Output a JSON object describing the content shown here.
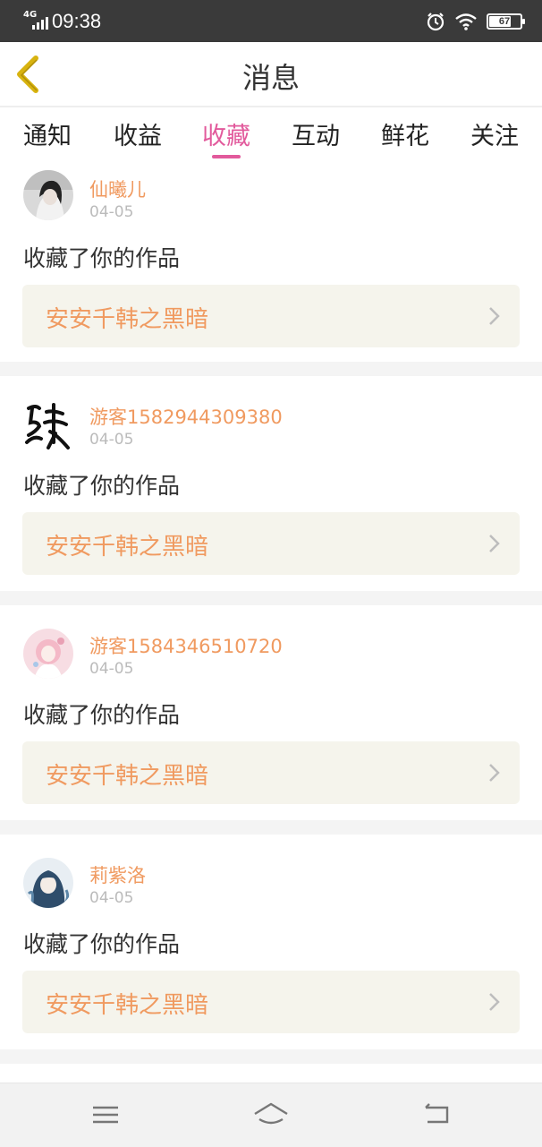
{
  "status_bar": {
    "network": "4G",
    "time": "09:38",
    "battery": "67",
    "battery_level": 0.67,
    "icons": [
      "signal-icon",
      "alarm-icon",
      "wifi-icon",
      "battery-icon"
    ]
  },
  "header": {
    "title": "消息",
    "back_icon": "chevron-left-icon"
  },
  "tabs": [
    {
      "label": "通知"
    },
    {
      "label": "收益"
    },
    {
      "label": "收藏",
      "active": true
    },
    {
      "label": "互动"
    },
    {
      "label": "鲜花"
    },
    {
      "label": "关注"
    }
  ],
  "messages": [
    {
      "user": "仙曦儿",
      "date": "04-05",
      "action": "收藏了你的作品",
      "work": "安安千韩之黑暗"
    },
    {
      "user": "游客1582944309380",
      "date": "04-05",
      "action": "收藏了你的作品",
      "work": "安安千韩之黑暗"
    },
    {
      "user": "游客1584346510720",
      "date": "04-05",
      "action": "收藏了你的作品",
      "work": "安安千韩之黑暗"
    },
    {
      "user": "莉紫洛",
      "date": "04-05",
      "action": "收藏了你的作品",
      "work": "安安千韩之黑暗"
    }
  ],
  "bottom_nav": [
    "menu-icon",
    "home-icon",
    "back-icon"
  ],
  "colors": {
    "accent_pink": "#e25a9c",
    "orange_text": "#f09a60",
    "back_arrow": "#d8b30f",
    "card_box": "#f5f4ec"
  }
}
